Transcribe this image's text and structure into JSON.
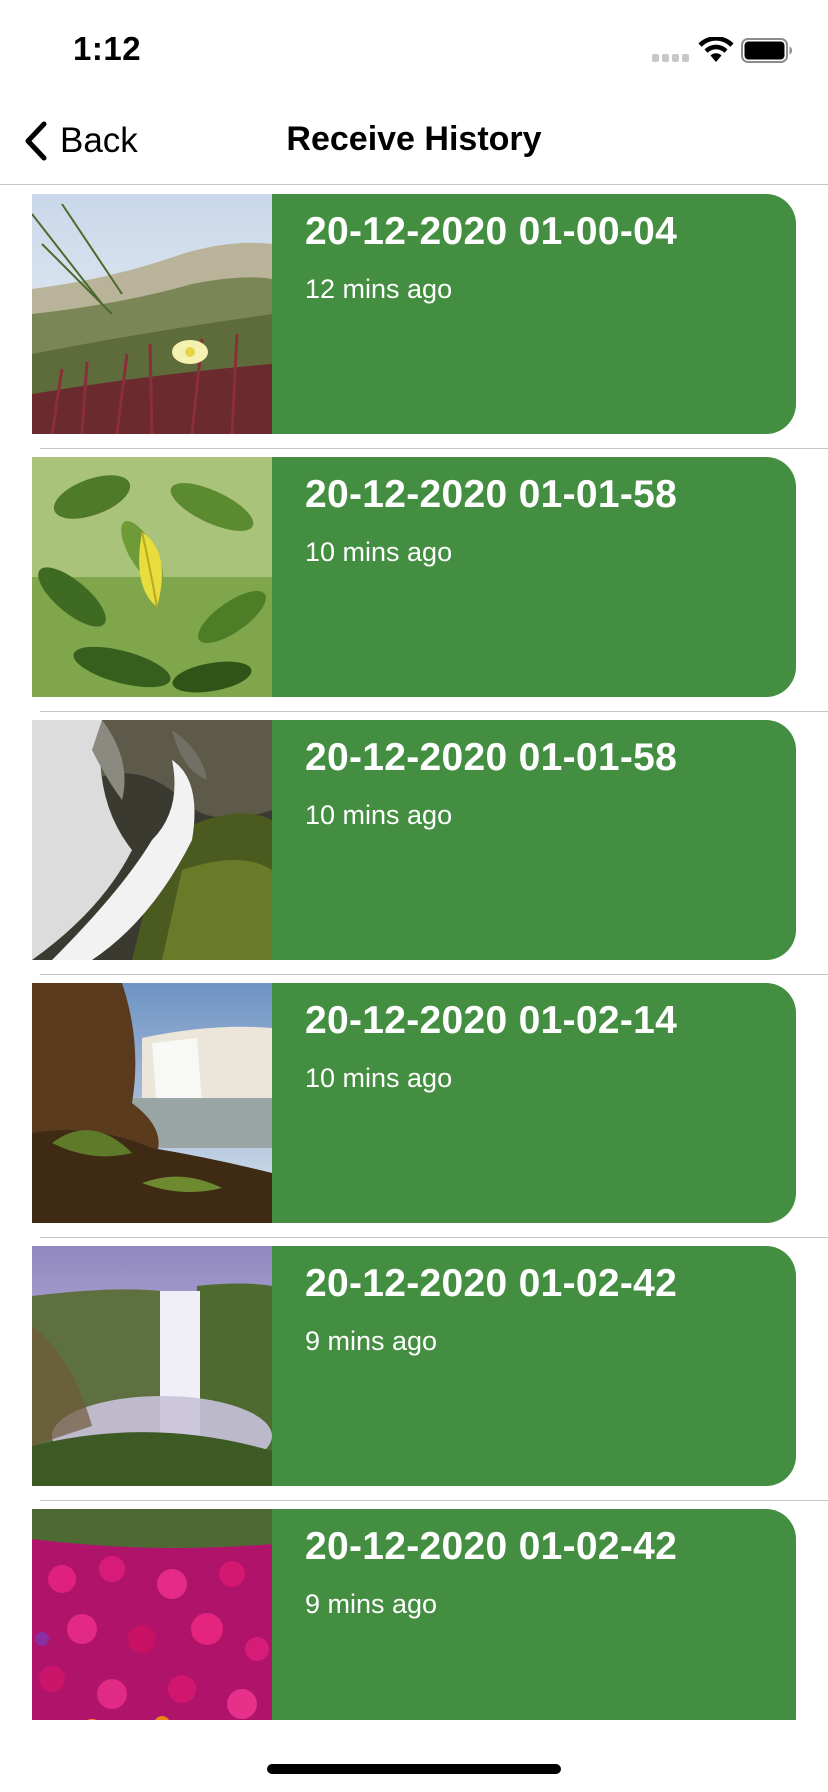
{
  "status_bar": {
    "time": "1:12"
  },
  "nav": {
    "back_label": "Back",
    "title": "Receive History"
  },
  "colors": {
    "card_bg": "#438e40",
    "card_text": "#ffffff",
    "separator": "#c6c6c8"
  },
  "items": [
    {
      "title": "20-12-2020 01-00-04",
      "time_ago": "12 mins ago",
      "thumbnail": "coastal-plants-photo"
    },
    {
      "title": "20-12-2020 01-01-58",
      "time_ago": "10 mins ago",
      "thumbnail": "yellow-leaf-photo"
    },
    {
      "title": "20-12-2020 01-01-58",
      "time_ago": "10 mins ago",
      "thumbnail": "waterfall-rocks-photo"
    },
    {
      "title": "20-12-2020 01-02-14",
      "time_ago": "10 mins ago",
      "thumbnail": "waterfall-cliff-photo"
    },
    {
      "title": "20-12-2020 01-02-42",
      "time_ago": "9 mins ago",
      "thumbnail": "misty-waterfall-photo"
    },
    {
      "title": "20-12-2020 01-02-42",
      "time_ago": "9 mins ago",
      "thumbnail": "pink-flowers-photo"
    }
  ]
}
